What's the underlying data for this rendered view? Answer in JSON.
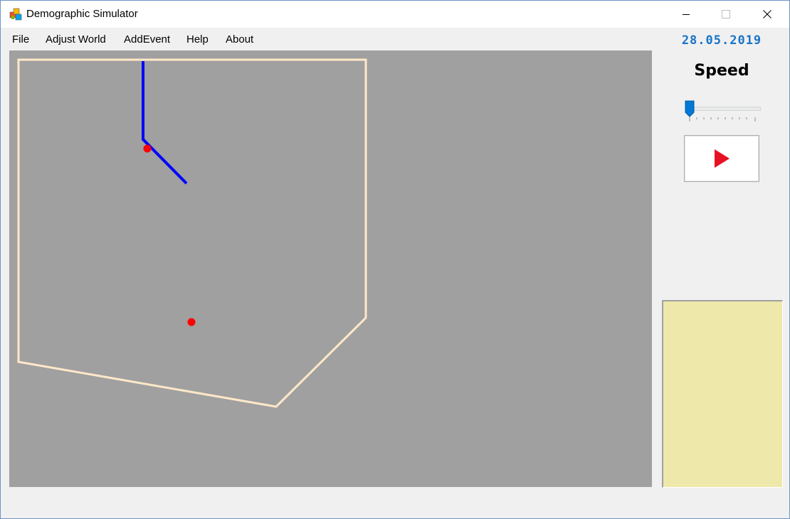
{
  "window": {
    "title": "Demographic Simulator",
    "minimize_icon": "minimize-icon",
    "maximize_icon": "maximize-icon",
    "close_icon": "close-icon"
  },
  "menu": {
    "items": [
      {
        "label": "File"
      },
      {
        "label": "Adjust World"
      },
      {
        "label": "AddEvent"
      },
      {
        "label": "Help"
      },
      {
        "label": "About"
      }
    ]
  },
  "sidebar": {
    "date": "28.05.2019",
    "speed_label": "Speed",
    "speed_value": 0,
    "play_icon": "play-icon"
  },
  "colors": {
    "map_background": "#a0a0a0",
    "border": "#ffe8c8",
    "road": "#0000ff",
    "settlement": "#ff0000",
    "date_text": "#1874c9",
    "info_panel": "#eee8aa",
    "play_icon": "#e81123"
  }
}
